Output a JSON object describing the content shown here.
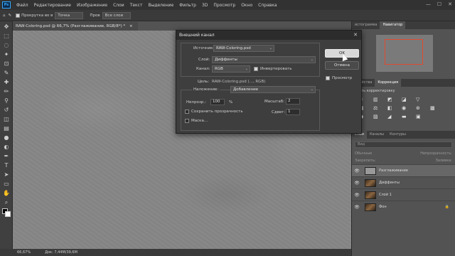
{
  "menubar": {
    "logo": "Ps",
    "items": [
      "Файл",
      "Редактирование",
      "Изображение",
      "Слои",
      "Текст",
      "Выделение",
      "Фильтр",
      "3D",
      "Просмотр",
      "Окно",
      "Справка"
    ],
    "window_controls": [
      "—",
      "☐",
      "✕"
    ]
  },
  "options_bar": {
    "tool_icon": "eyedropper-icon",
    "auto_scroll_label": "Прокрутка во в",
    "sample_size": "Точка",
    "sample_label": "Пров",
    "sample_layers": "Все слои"
  },
  "document": {
    "tab_title": "RAW-Coloring.psd @ 66,7% (Разглаживание, RGB/8*) *",
    "close": "×"
  },
  "status_bar": {
    "zoom": "66,67%",
    "doc_size": "Док: 7,44M/39,6M"
  },
  "right_panels": {
    "top_tabs": [
      "истограмма",
      "Навигатор"
    ],
    "mid_tabs": [
      "Свойства",
      "Коррекция"
    ],
    "corrections_title": "авить корректировку",
    "layers_tabs": [
      "Слои",
      "Каналы",
      "Контуры"
    ],
    "layers_search": "Вид",
    "blend_mode": "Обычные",
    "opacity_label": "Непрозрачность:",
    "lock_label": "Закрепить:",
    "fill_label": "Заливка:",
    "layers": [
      {
        "name": "Разглаживание",
        "thumb": "gray",
        "selected": true,
        "fx": ""
      },
      {
        "name": "Диффенты",
        "thumb": "img",
        "selected": false,
        "fx": ""
      },
      {
        "name": "Слой 1",
        "thumb": "img",
        "selected": false,
        "fx": ""
      },
      {
        "name": "Фон",
        "thumb": "img",
        "selected": false,
        "fx": ""
      }
    ]
  },
  "dialog": {
    "title": "Внешний канал",
    "close": "✕",
    "source_label": "Источник:",
    "source_value": "RAW-Coloring.psd",
    "layer_label": "Слой:",
    "layer_value": "Диффенты",
    "channel_label": "Канал:",
    "channel_value": "RGB",
    "invert_label": "Инвертировать",
    "invert_checked": true,
    "target_label": "Цель:",
    "target_value": "RAW-Coloring.psd (..., RGB)",
    "blending_label": "Наложение:",
    "blending_value": "Добавление",
    "opacity_label": "Непрозр.:",
    "opacity_value": "100",
    "opacity_unit": "%",
    "preserve_label": "Сохранить прозрачность",
    "mask_label": "Маска...",
    "scale_label": "Масштаб:",
    "scale_value": "2",
    "offset_label": "Сдвиг:",
    "offset_value": "1",
    "ok_label": "OK",
    "cancel_label": "Отмена",
    "preview_label": "Просмотр",
    "preview_checked": true
  }
}
